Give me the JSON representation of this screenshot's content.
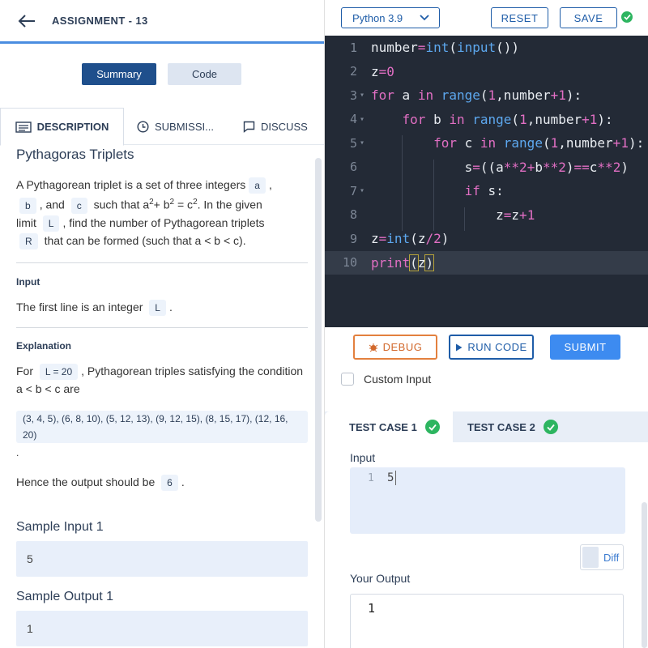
{
  "header": {
    "title": "ASSIGNMENT - 13"
  },
  "view_toggle": {
    "summary": "Summary",
    "code": "Code"
  },
  "tabs": {
    "description": "DESCRIPTION",
    "submissions": "SUBMISSI...",
    "discuss": "DISCUSS"
  },
  "problem": {
    "title": "Pythagoras Triplets",
    "statement": {
      "p1": "A Pythagorean triplet is a set of three integers",
      "var_a": "a",
      "comma": ",",
      "var_b": "b",
      "and": ", and",
      "var_c": "c",
      "such_that": "such that a",
      "sq": "2",
      "plus_b": "+ b",
      "eq_c": " = c",
      "given": ". In the given",
      "limit": "limit",
      "var_L": "L",
      "find": ", find the number of Pythagorean triplets",
      "var_R": "R",
      "formed": "that can be formed (such that a < b < c)."
    },
    "input_heading": "Input",
    "input_text": "The first line is an integer",
    "input_var": "L",
    "period": ".",
    "explanation_heading": "Explanation",
    "expl_for": "For",
    "expl_chip": "L = 20",
    "expl_rest": ", Pythagorean triples satisfying the condition a < b < c are",
    "triples": "(3, 4, 5), (6, 8, 10), (5, 12, 13), (9, 12, 15), (8, 15, 17), (12, 16, 20)",
    "hence": "Hence the output should be",
    "hence_val": "6",
    "sample_input_label": "Sample Input 1",
    "sample_input_value": "5",
    "sample_output_label": "Sample Output 1",
    "sample_output_value": "1"
  },
  "editor_toolbar": {
    "language": "Python 3.9",
    "reset": "RESET",
    "save": "SAVE"
  },
  "code_lines": [
    "1",
    "2",
    "3",
    "4",
    "5",
    "6",
    "7",
    "8",
    "9",
    "10"
  ],
  "actions": {
    "debug": "DEBUG",
    "run": "RUN CODE",
    "submit": "SUBMIT",
    "custom_input": "Custom Input"
  },
  "testcases": {
    "tc1": "TEST CASE 1",
    "tc2": "TEST CASE 2"
  },
  "io": {
    "input_label": "Input",
    "input_line_no": "1",
    "input_value": "5",
    "diff_label": "Diff",
    "output_label": "Your Output",
    "output_value": "1"
  },
  "colors": {
    "accent": "#1f5da8",
    "success": "#2db560",
    "editor_bg": "#232a36",
    "debug": "#d2692c"
  }
}
